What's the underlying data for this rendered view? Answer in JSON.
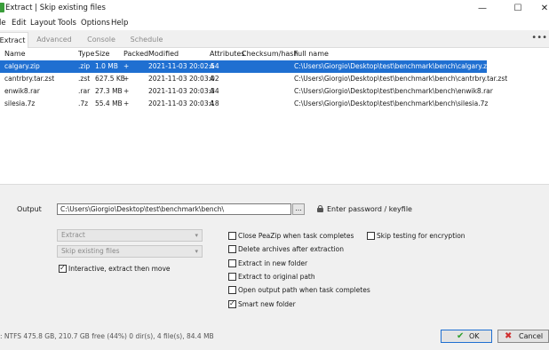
{
  "window": {
    "title": "Extract | Skip existing files",
    "minimize_glyph": "—",
    "maximize_glyph": "☐",
    "close_glyph": "✕"
  },
  "menu": [
    "le",
    "Edit",
    "Layout",
    "Tools",
    "Options",
    "Help"
  ],
  "tabs": [
    {
      "label": "Extract",
      "active": true
    },
    {
      "label": "Advanced",
      "active": false
    },
    {
      "label": "Console",
      "active": false
    },
    {
      "label": "Schedule",
      "active": false
    }
  ],
  "more_glyph": "•••",
  "list": {
    "columns": [
      "Name",
      "Type",
      "Size",
      "Packed",
      "Modified",
      "Attributes",
      "Checksum/hash",
      "Full name"
    ],
    "rows": [
      {
        "name": "calgary.zip",
        "type": ".zip",
        "size": "1.0 MB",
        "packed": "+",
        "modified": "2021-11-03 20:02:54",
        "attributes": "A",
        "checksum": "",
        "full_name": "C:\\Users\\Giorgio\\Desktop\\test\\benchmark\\bench\\calgary.zip",
        "selected": true
      },
      {
        "name": "cantrbry.tar.zst",
        "type": ".zst",
        "size": "627.5 KB",
        "packed": "+",
        "modified": "2021-11-03 20:03:02",
        "attributes": "A",
        "checksum": "",
        "full_name": "C:\\Users\\Giorgio\\Desktop\\test\\benchmark\\bench\\cantrbry.tar.zst",
        "selected": false
      },
      {
        "name": "enwik8.rar",
        "type": ".rar",
        "size": "27.3 MB",
        "packed": "+",
        "modified": "2021-11-03 20:03:34",
        "attributes": "A",
        "checksum": "",
        "full_name": "C:\\Users\\Giorgio\\Desktop\\test\\benchmark\\bench\\enwik8.rar",
        "selected": false
      },
      {
        "name": "silesia.7z",
        "type": ".7z",
        "size": "55.4 MB",
        "packed": "+",
        "modified": "2021-11-03 20:03:18",
        "attributes": "A",
        "checksum": "",
        "full_name": "C:\\Users\\Giorgio\\Desktop\\test\\benchmark\\bench\\silesia.7z",
        "selected": false
      }
    ]
  },
  "output": {
    "label": "Output",
    "value": "C:\\Users\\Giorgio\\Desktop\\test\\benchmark\\bench\\",
    "browse_label": "...",
    "password_label": "Enter password / keyfile"
  },
  "selects": {
    "mode": "Extract",
    "existing": "Skip existing files",
    "arrow_glyph": "▾"
  },
  "options": [
    {
      "label": "Interactive, extract then move",
      "checked": true
    },
    {
      "label": "Close PeaZip when task completes",
      "checked": false
    },
    {
      "label": "Delete archives after extraction",
      "checked": false
    },
    {
      "label": "Extract in new folder",
      "checked": false
    },
    {
      "label": "Extract to original path",
      "checked": false
    },
    {
      "label": "Open output path when task completes",
      "checked": false
    },
    {
      "label": "Smart new folder",
      "checked": true
    },
    {
      "label": "Skip testing for encryption",
      "checked": false
    }
  ],
  "check_glyph": "✓",
  "status": ": NTFS 475.8 GB, 210.7 GB free (44%)     0 dir(s), 4 file(s), 84.4 MB",
  "buttons": {
    "ok": "OK",
    "cancel": "Cancel",
    "ok_icon_glyph": "✔",
    "cancel_icon_glyph": "✖"
  },
  "colors": {
    "selection": "#1f6fd1",
    "ok_icon": "#2e9e2e",
    "cancel_icon": "#d03030"
  }
}
